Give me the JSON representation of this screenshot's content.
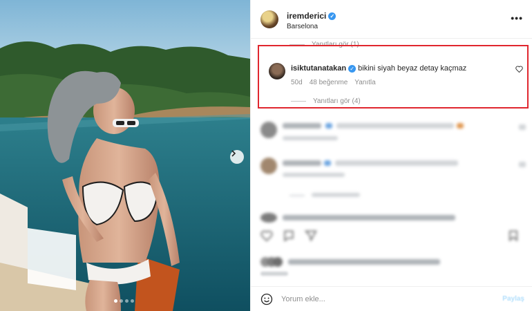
{
  "post": {
    "username": "iremderici",
    "location": "Barselona",
    "more_label": "•••",
    "verified_icon": "✓"
  },
  "top_replies": {
    "label": "Yanıtları gör (1)"
  },
  "highlighted_comment": {
    "username": "isiktutanatakan",
    "text": "bikini siyah beyaz detay kaçmaz",
    "time": "50d",
    "likes": "48 beğenme",
    "reply": "Yanıtla",
    "view_replies": "Yanıtları gör (4)"
  },
  "footer": {
    "input_placeholder": "Yorum ekle...",
    "post_label": "Paylaş"
  },
  "colors": {
    "highlight_border": "#e0262e",
    "verified": "#3897f0",
    "muted_text": "#8e8e8e"
  },
  "carousel": {
    "slide_index": 1,
    "slide_count": 4
  }
}
